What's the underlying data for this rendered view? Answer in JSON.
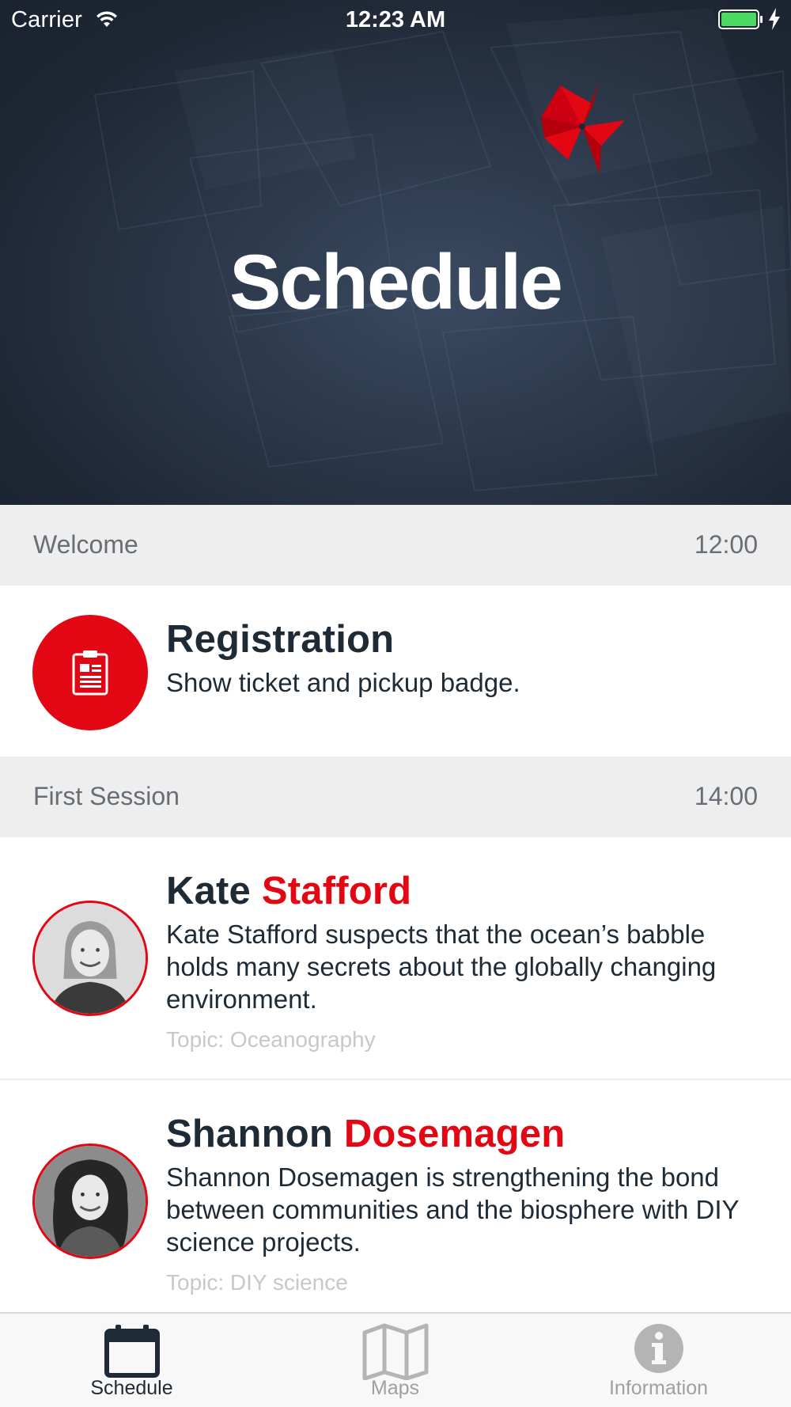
{
  "status_bar": {
    "carrier": "Carrier",
    "time": "12:23 AM",
    "battery_level": 1.0,
    "charging": true
  },
  "hero": {
    "title": "Schedule",
    "logo_icon": "pinwheel-icon"
  },
  "sections": [
    {
      "name": "Welcome",
      "time": "12:00",
      "items": [
        {
          "type": "event",
          "icon": "clipboard-icon",
          "title": "Registration",
          "description": "Show ticket and pickup badge."
        }
      ]
    },
    {
      "name": "First Session",
      "time": "14:00",
      "items": [
        {
          "type": "speaker",
          "first_name": "Kate",
          "last_name": "Stafford",
          "description": "Kate Stafford suspects that the ocean’s babble holds many secrets about the globally changing environment.",
          "topic": "Topic: Oceanography"
        },
        {
          "type": "speaker",
          "first_name": "Shannon",
          "last_name": "Dosemagen",
          "description": "Shannon Dosemagen is strengthening the bond between communities and the biosphere with DIY science projects.",
          "topic": "Topic: DIY science"
        }
      ]
    }
  ],
  "tab_bar": {
    "tabs": [
      {
        "label": "Schedule",
        "icon": "calendar-icon",
        "active": true
      },
      {
        "label": "Maps",
        "icon": "map-icon",
        "active": false
      },
      {
        "label": "Information",
        "icon": "info-icon",
        "active": false
      }
    ]
  },
  "colors": {
    "accent": "#e30613",
    "hero_bg": "#2c384b",
    "text_dark": "#1e2b36",
    "section_bg": "#eeeeee",
    "topic_gray": "#c8c8c8"
  }
}
